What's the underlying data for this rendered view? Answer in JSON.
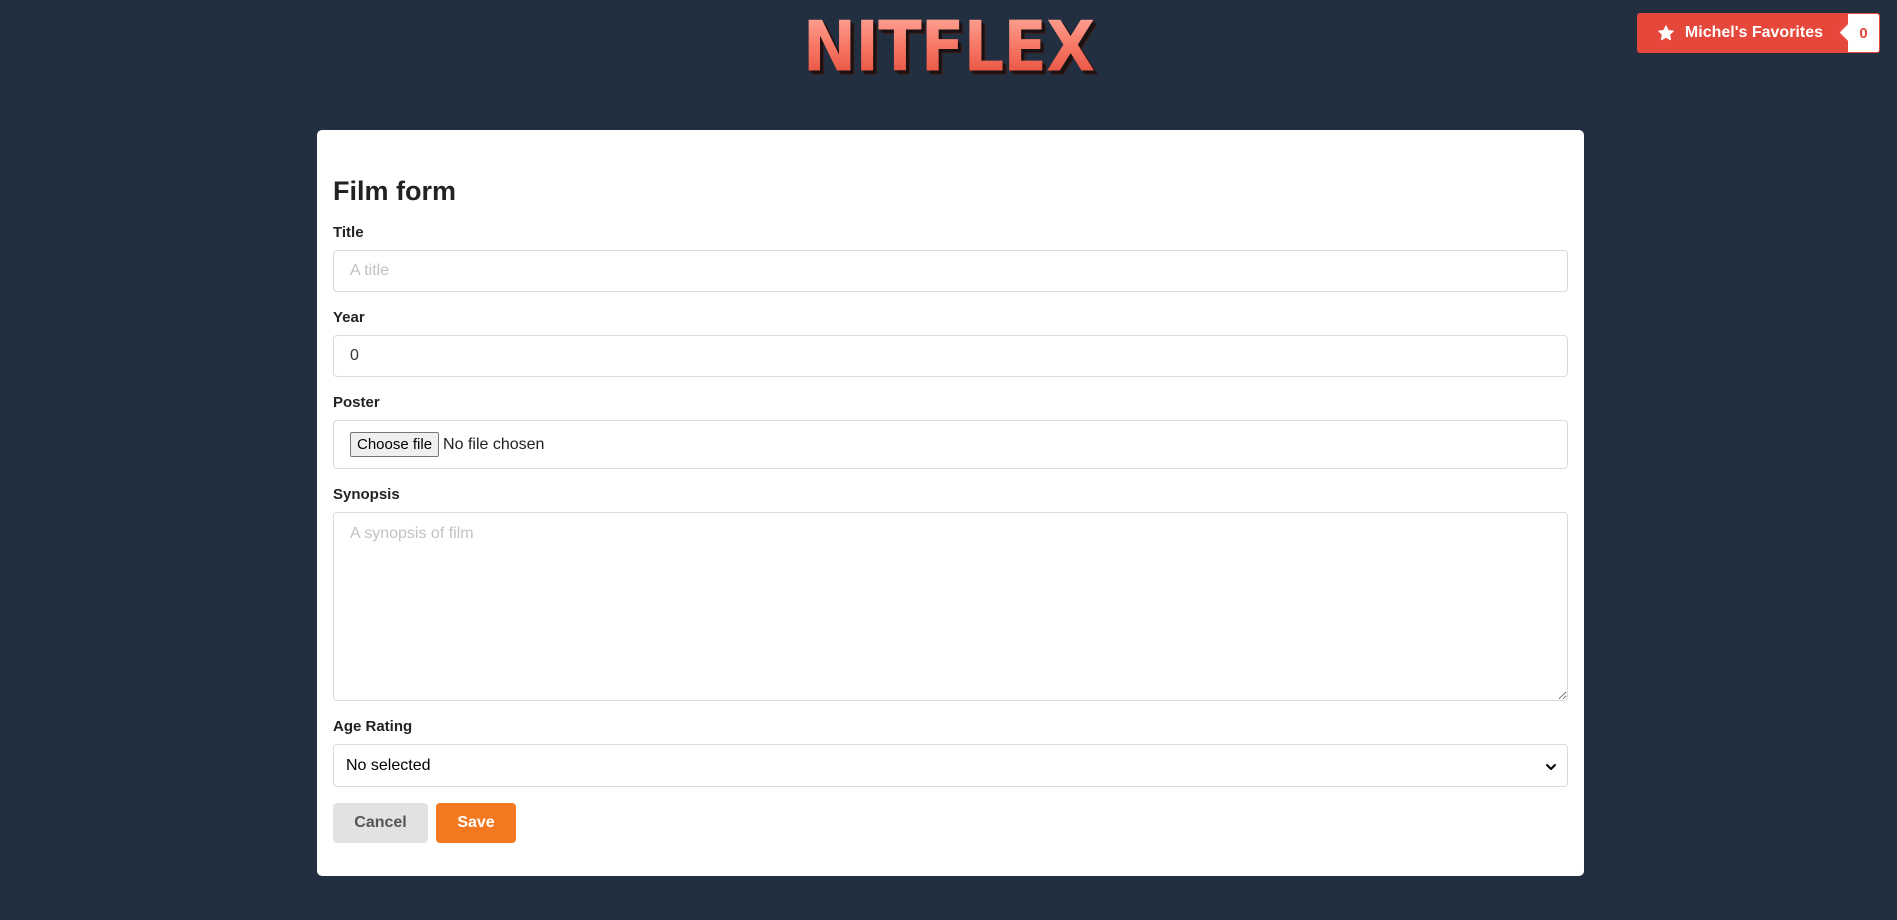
{
  "header": {
    "logo_text": "NITFLEX",
    "favorites_label": "Michel's Favorites",
    "favorites_count": "0",
    "favorites_icon": "star-icon"
  },
  "form": {
    "title": "Film form",
    "fields": {
      "title": {
        "label": "Title",
        "placeholder": "A title",
        "value": ""
      },
      "year": {
        "label": "Year",
        "value": "0"
      },
      "poster": {
        "label": "Poster",
        "button_label": "Choose file",
        "status": "No file chosen"
      },
      "synopsis": {
        "label": "Synopsis",
        "placeholder": "A synopsis of film",
        "value": ""
      },
      "age_rating": {
        "label": "Age Rating",
        "selected": "No selected"
      }
    },
    "buttons": {
      "cancel": "Cancel",
      "save": "Save"
    }
  },
  "colors": {
    "background": "#222f41",
    "brand_red": "#e5473b",
    "save_orange": "#f47820",
    "cancel_gray": "#e2e2e2"
  }
}
